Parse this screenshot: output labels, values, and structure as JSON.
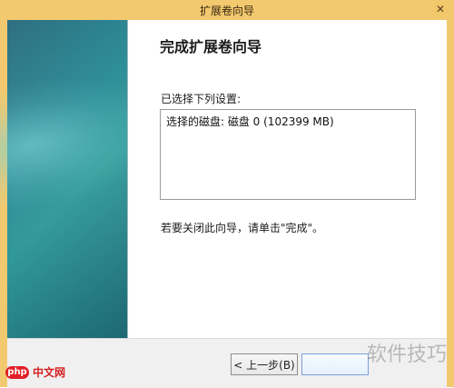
{
  "window": {
    "title": "扩展卷向导",
    "close_icon": "✕"
  },
  "main": {
    "title": "完成扩展卷向导",
    "selected_settings_label": "已选择下列设置:",
    "summary_text": "选择的磁盘: 磁盘 0 (102399 MB)",
    "close_hint": "若要关闭此向导，请单击\"完成\"。"
  },
  "footer": {
    "back_label": "< 上一步(B)",
    "finish_label": ""
  },
  "watermarks": {
    "left_badge": "php",
    "left_text": "中文网",
    "right_text": "软件技巧"
  }
}
